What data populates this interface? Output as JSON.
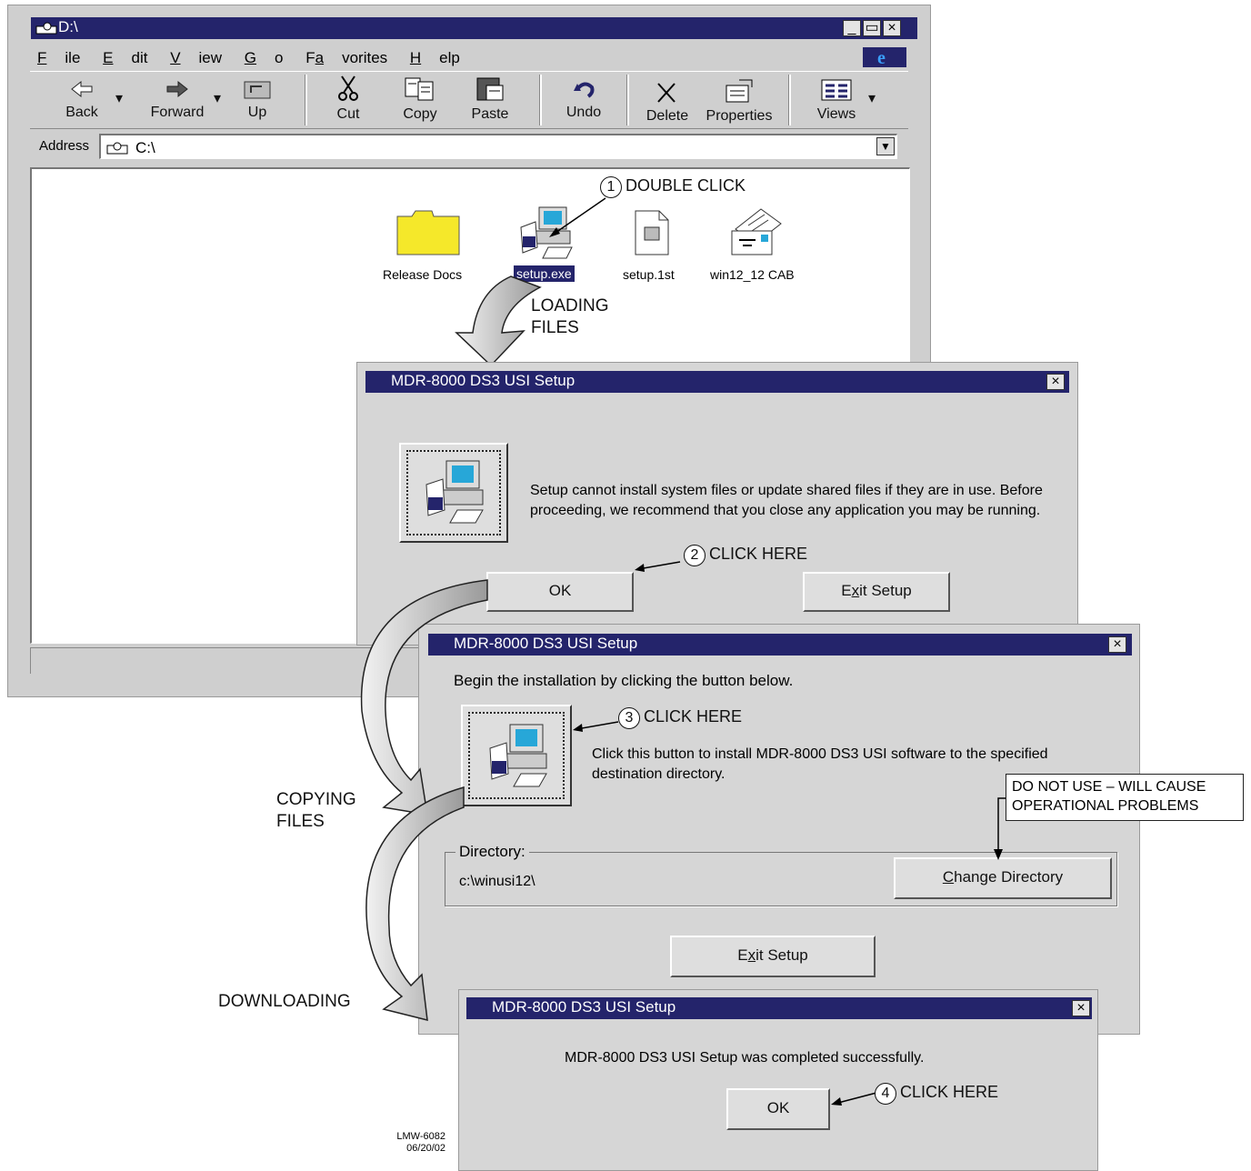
{
  "explorer": {
    "title": "D:\\",
    "menu": [
      "File",
      "Edit",
      "View",
      "Go",
      "Favorites",
      "Help"
    ],
    "toolbar": {
      "back": "Back",
      "forward": "Forward",
      "up": "Up",
      "cut": "Cut",
      "copy": "Copy",
      "paste": "Paste",
      "undo": "Undo",
      "delete": "Delete",
      "properties": "Properties",
      "views": "Views"
    },
    "address_label": "Address",
    "address_value": "C:\\",
    "files": [
      {
        "name": "Release Docs",
        "icon": "folder-icon"
      },
      {
        "name": "setup.exe",
        "icon": "setup-computer-icon",
        "selected": true
      },
      {
        "name": "setup.1st",
        "icon": "document-icon"
      },
      {
        "name": "win12_12 CAB",
        "icon": "cabinet-icon"
      }
    ]
  },
  "dialog1": {
    "title": "MDR-8000 DS3 USI Setup",
    "message": "Setup cannot install system files or update shared files if they are in use. Before proceeding, we recommend that you close any application you may be running.",
    "ok_label": "OK",
    "exit_label_pre": "E",
    "exit_label_u": "x",
    "exit_label_post": "it Setup"
  },
  "dialog2": {
    "title": "MDR-8000 DS3 USI Setup",
    "intro": "Begin the installation by clicking the button below.",
    "install_text": "Click this button to install MDR-8000 DS3 USI software to the specified destination directory.",
    "directory_label": "Directory:",
    "directory_value": "c:\\winusi12\\",
    "change_dir_u": "C",
    "change_dir_post": "hange Directory",
    "exit_label_pre": "E",
    "exit_label_u": "x",
    "exit_label_post": "it Setup"
  },
  "dialog3": {
    "title": "MDR-8000 DS3 USI Setup",
    "message": "MDR-8000 DS3 USI Setup was completed successfully.",
    "ok_label": "OK"
  },
  "annotations": {
    "step1": {
      "num": "1",
      "text": "DOUBLE CLICK"
    },
    "step2": {
      "num": "2",
      "text": "CLICK HERE"
    },
    "step3": {
      "num": "3",
      "text": "CLICK HERE"
    },
    "step4": {
      "num": "4",
      "text": "CLICK HERE"
    },
    "loading_line1": "LOADING",
    "loading_line2": "FILES",
    "copying_line1": "COPYING",
    "copying_line2": "FILES",
    "downloading": "DOWNLOADING",
    "warning_line1": "DO NOT USE – WILL CAUSE",
    "warning_line2": "OPERATIONAL PROBLEMS",
    "figure_id": "LMW-6082",
    "figure_date": "06/20/02"
  },
  "colors": {
    "titlebar": "#24246b",
    "window": "#d6d6d6",
    "selection": "#24246b"
  }
}
